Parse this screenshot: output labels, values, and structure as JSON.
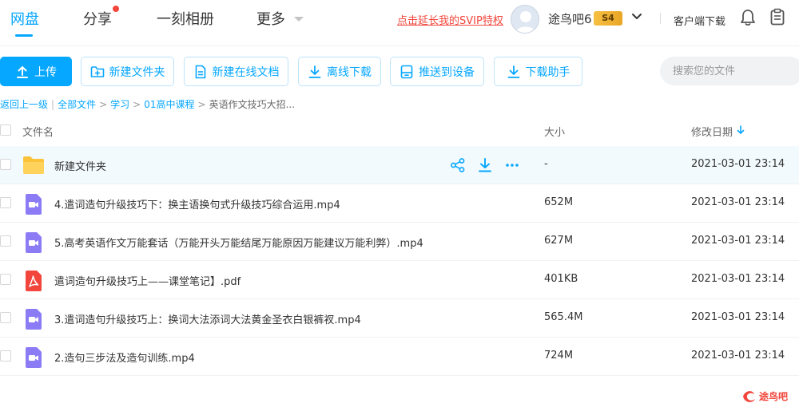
{
  "nav": {
    "tabs": [
      {
        "label": "网盘",
        "active": true
      },
      {
        "label": "分享",
        "has_dot": true
      },
      {
        "label": "一刻相册"
      },
      {
        "label": "更多"
      }
    ],
    "promo": "点击延长我的SVIP特权",
    "username": "途鸟吧6",
    "vip_level": "S4",
    "client_download": "客户端下载"
  },
  "toolbar": {
    "upload": "上传",
    "new_folder": "新建文件夹",
    "new_doc": "新建在线文档",
    "offline_download": "离线下载",
    "push_device": "推送到设备",
    "download_helper": "下载助手",
    "search_placeholder": "搜索您的文件"
  },
  "breadcrumb": {
    "back": "返回上一级",
    "all": "全部文件",
    "path": [
      "学习",
      "01高中课程"
    ],
    "current": "英语作文技巧大招..."
  },
  "table": {
    "columns": {
      "name": "文件名",
      "size": "大小",
      "date": "修改日期"
    },
    "sort": "date-desc",
    "rows": [
      {
        "type": "folder",
        "name": "新建文件夹",
        "size": "-",
        "date": "2021-03-01 23:14",
        "hovered": true
      },
      {
        "type": "video",
        "name": "4.遣词造句升级技巧下：换主语换句式升级技巧综合运用.mp4",
        "size": "652M",
        "date": "2021-03-01 23:14"
      },
      {
        "type": "video",
        "name": "5.高考英语作文万能套话（万能开头万能结尾万能原因万能建议万能利弊）.mp4",
        "size": "627M",
        "date": "2021-03-01 23:14"
      },
      {
        "type": "pdf",
        "name": "遣词造句升级技巧上——课堂笔记】.pdf",
        "size": "401KB",
        "date": "2021-03-01 23:14"
      },
      {
        "type": "video",
        "name": "3.遣词造句升级技巧上：换词大法添词大法黄金圣衣白银裤衩.mp4",
        "size": "565.4M",
        "date": "2021-03-01 23:14"
      },
      {
        "type": "video",
        "name": "2.造句三步法及造句训练.mp4",
        "size": "724M",
        "date": "2021-03-01 23:14"
      }
    ]
  },
  "watermark": "途鸟吧",
  "colors": {
    "accent": "#06a7ff",
    "promo": "#f2453b",
    "folder": "#fcc33a",
    "video": "#8b7cf6",
    "pdf": "#f2453b"
  }
}
